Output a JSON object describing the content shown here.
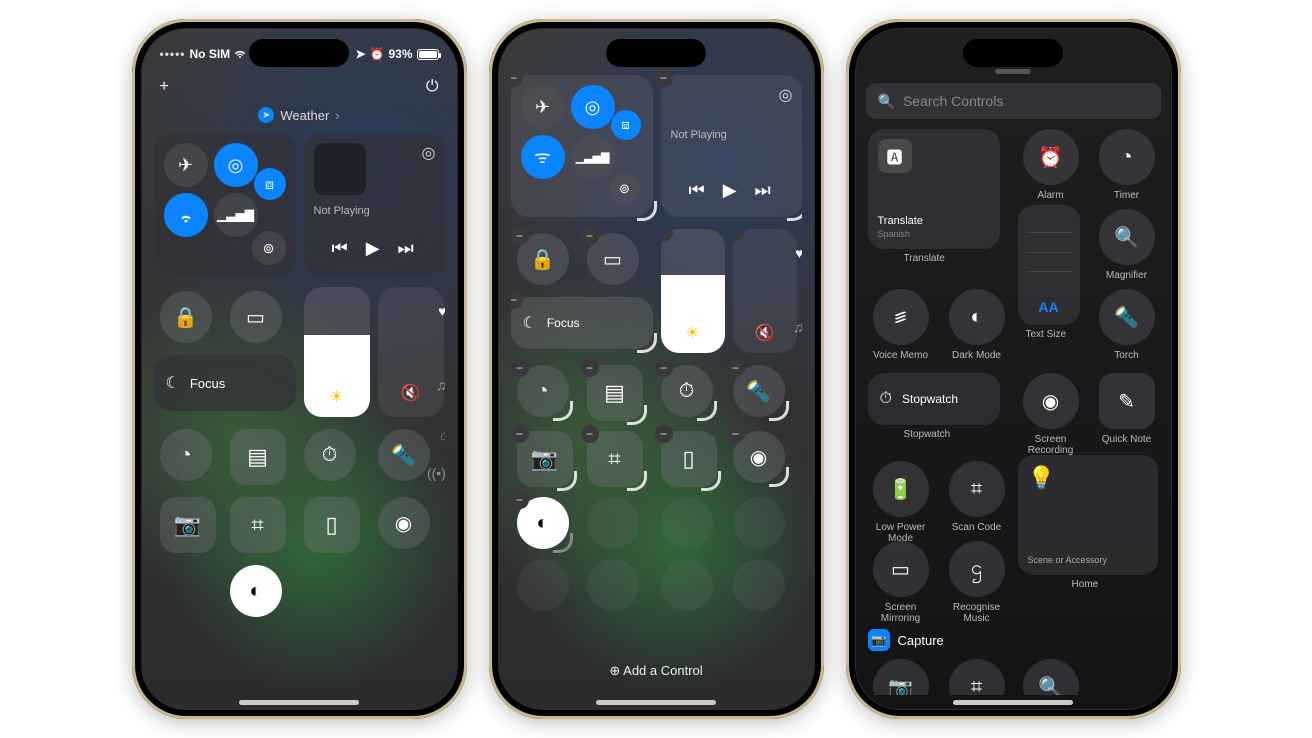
{
  "statusbar": {
    "carrier": "No SIM",
    "battery_pct": "93%",
    "alarm_icon": "⏰",
    "location_icon": "➤"
  },
  "top": {
    "add": "+",
    "power": "⏻",
    "crumb_app": "Weather"
  },
  "connectivity": {
    "airplane": "airplane",
    "airdrop": "airdrop",
    "wifi": "wifi",
    "cellular": "cellular",
    "bluetooth": "bluetooth",
    "hotspot": "hotspot"
  },
  "media": {
    "status": "Not Playing",
    "airplay": "airplay",
    "prev": "⏮",
    "play": "▶",
    "next": "⏭"
  },
  "controls": {
    "rotation_lock": "rotation-lock",
    "screen_mirror": "screen-mirroring",
    "focus_label": "Focus",
    "brightness_pct": 63,
    "volume_pct": 0,
    "heart": "♥",
    "music": "♫",
    "home_icon": "⌂",
    "antenna": "((•))"
  },
  "row_icons": {
    "timer": "timer",
    "calculator": "calculator",
    "stopwatch": "stopwatch",
    "torch": "torch",
    "camera": "camera",
    "qr": "qr-scan",
    "remote": "apple-tv-remote",
    "record": "screen-record",
    "dark_mode": "dark-mode"
  },
  "edit": {
    "add_control": "Add a Control"
  },
  "gallery": {
    "search_placeholder": "Search Controls",
    "translate": {
      "title": "Translate",
      "subtitle": "Spanish",
      "caption": "Translate"
    },
    "alarm": "Alarm",
    "timer": "Timer",
    "magnifier": "Magnifier",
    "voice_memo": "Voice Memo",
    "dark_mode": "Dark Mode",
    "text_size": "Text Size",
    "torch": "Torch",
    "stopwatch_pill": "Stopwatch",
    "stopwatch": "Stopwatch",
    "screen_recording": "Screen Recording",
    "quick_note": "Quick Note",
    "low_power": "Low Power Mode",
    "scan_code": "Scan Code",
    "scene": "Scene or Accessory",
    "home": "Home",
    "screen_mirroring": "Screen Mirroring",
    "recognise_music": "Recognise Music",
    "section_capture": "Capture"
  }
}
